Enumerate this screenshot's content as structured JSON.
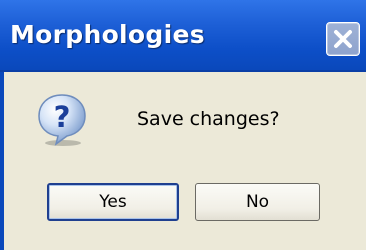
{
  "window": {
    "title": "Morphologies"
  },
  "dialog": {
    "message": "Save changes?",
    "icon": "question-icon"
  },
  "buttons": {
    "yes_label": "Yes",
    "no_label": "No"
  },
  "colors": {
    "titlebar": "#0d4fc8",
    "dialog_background": "#ece9d8",
    "close_button": "#8ea3cd"
  }
}
